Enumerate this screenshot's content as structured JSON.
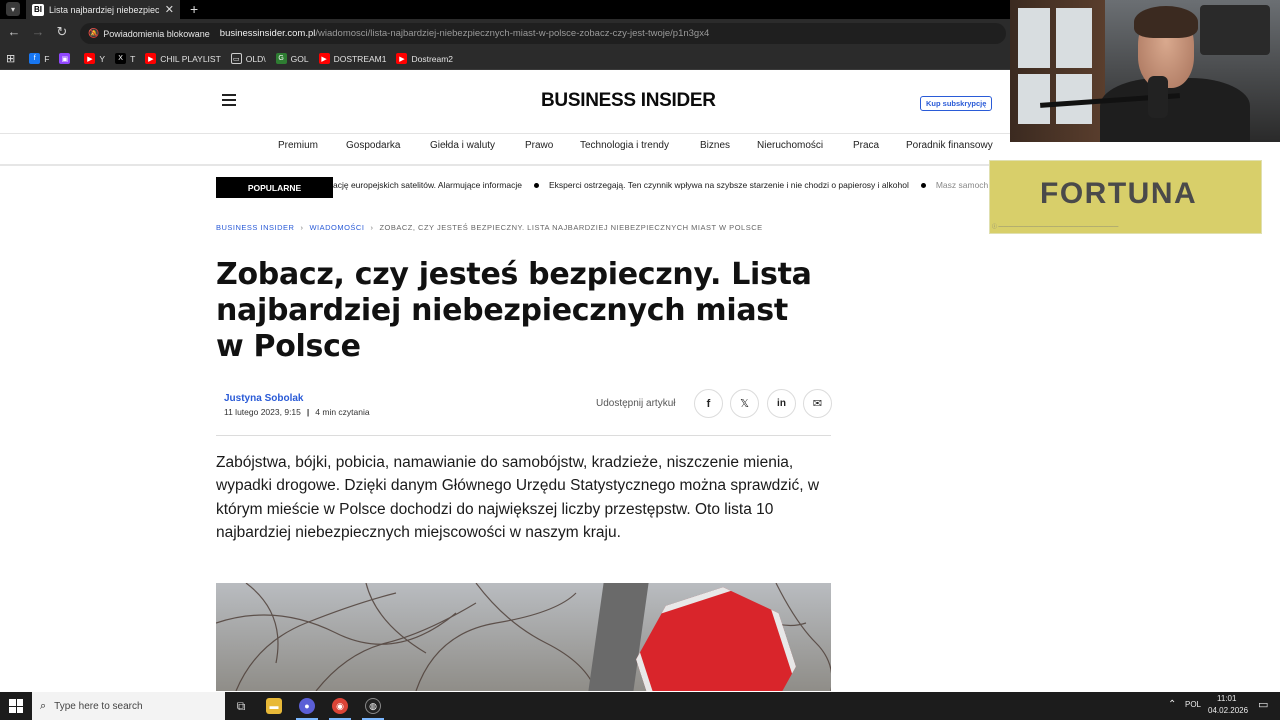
{
  "browser": {
    "tab_title": "Lista najbardziej niebezpieczn...",
    "tab_favicon": "BI",
    "new_tab": "+",
    "blocked_label": "Powiadomienia blokowane",
    "url_domain": "businessinsider.com.pl",
    "url_path": "/wiadomosci/lista-najbardziej-niebezpiecznych-miast-w-polsce-zobacz-czy-jest-twoje/p1n3gx4",
    "bookmarks": [
      {
        "label": "F",
        "icon": "facebook-icon",
        "color": "#1877f2"
      },
      {
        "label": "",
        "icon": "twitch-icon",
        "color": "#9146ff"
      },
      {
        "label": "Y",
        "icon": "youtube-icon",
        "color": "#ff0000"
      },
      {
        "label": "T",
        "icon": "x-icon",
        "color": "#000000"
      },
      {
        "label": "CHIL PLAYLIST",
        "icon": "youtube-icon",
        "color": "#ff0000"
      },
      {
        "label": "OLD\\",
        "icon": "folder-icon",
        "color": "#2b2b2b"
      },
      {
        "label": "GOL",
        "icon": "gol-icon",
        "color": "#2e7d32"
      },
      {
        "label": "DOSTREAM1",
        "icon": "youtube-icon",
        "color": "#ff0000"
      },
      {
        "label": "Dostream2",
        "icon": "youtube-icon",
        "color": "#ff0000"
      }
    ]
  },
  "header": {
    "logo": "BUSINESS INSIDER",
    "subscribe": "Kup subskrypcję"
  },
  "nav": [
    "Premium",
    "Gospodarka",
    "Giełda i waluty",
    "Prawo",
    "Technologia i trendy",
    "Biznes",
    "Nieruchomości",
    "Praca",
    "Poradnik finansowy"
  ],
  "popular": {
    "label": "POPULARNE",
    "items": [
      "ację europejskich satelitów. Alarmujące informacje",
      "Eksperci ostrzegają. Ten czynnik wpływa na szybsze starzenie i nie chodzi o papierosy i alkohol",
      "Masz samochód"
    ]
  },
  "ad": {
    "brand": "FORTUNA"
  },
  "breadcrumb": {
    "items": [
      "BUSINESS INSIDER",
      "WIADOMOŚCI"
    ],
    "current": "ZOBACZ, CZY JESTEŚ BEZPIECZNY. LISTA NAJBARDZIEJ NIEBEZPIECZNYCH MIAST W POLSCE"
  },
  "article": {
    "title": "Zobacz, czy jesteś bezpieczny. Lista najbardziej niebezpiecznych miast w Polsce",
    "author": "Justyna Sobolak",
    "date": "11 lutego 2023, 9:15",
    "read_time": "4 min czytania",
    "share_label": "Udostępnij artykuł",
    "lead": "Zabójstwa, bójki, pobicia, namawianie do samobójstw, kradzieże, niszczenie mienia, wypadki drogowe. Dzięki danym Głównego Urzędu Statystycznego można sprawdzić, w którym mieście w Polsce dochodzi do największej liczby przestępstw. Oto lista 10 najbardziej niebezpiecznych miejscowości w naszym kraju."
  },
  "taskbar": {
    "search_placeholder": "Type here to search",
    "lang": "POL",
    "time": "11:01",
    "date": "04.02.2026"
  }
}
